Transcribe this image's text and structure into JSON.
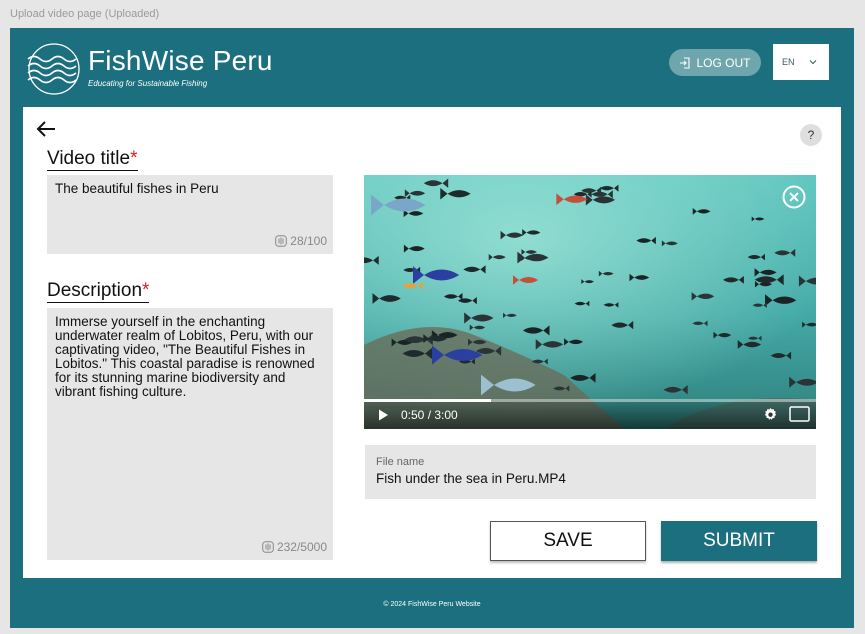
{
  "page_caption": "Upload video page (Uploaded)",
  "header": {
    "brand": "FishWise Peru",
    "tagline": "Educating for Sustainable Fishing",
    "logout_label": "LOG OUT",
    "language": "EN",
    "icons": {
      "logout": "logout-icon",
      "language": "chevron-down-icon",
      "logo": "waves-logo-icon"
    }
  },
  "form": {
    "back_icon": "arrow-left-icon",
    "help_label": "?",
    "title_label": "Video title",
    "title_required": "*",
    "title_value": "The beautiful fishes in Peru",
    "title_counter": "28/100",
    "description_label": "Description",
    "description_required": "*",
    "description_value": "Immerse yourself in the enchanting underwater realm of Lobitos, Peru, with our captivating video, \"The Beautiful Fishes in Lobitos.\" This coastal paradise is renowned for its stunning marine biodiversity and vibrant fishing culture.",
    "description_counter": "232/5000"
  },
  "video": {
    "time": "0:50 / 3:00",
    "progress": 0.28,
    "icons": {
      "close": "close-circle-icon",
      "play": "play-icon",
      "settings": "gear-icon",
      "fullscreen": "fullscreen-icon"
    }
  },
  "file": {
    "label": "File name",
    "value": "Fish under the sea in Peru.MP4"
  },
  "actions": {
    "save_label": "SAVE",
    "submit_label": "SUBMIT"
  },
  "footer": {
    "text": "© 2024 FishWise Peru Website"
  },
  "colors": {
    "brand": "#1c6f7e",
    "required": "#e0201c",
    "field_bg": "#e6e6e6"
  }
}
